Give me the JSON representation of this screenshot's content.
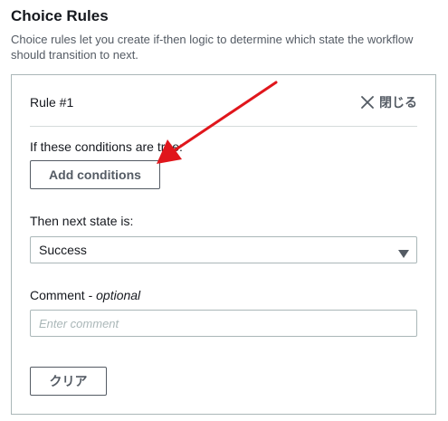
{
  "section": {
    "title": "Choice Rules",
    "description": "Choice rules let you create if-then logic to determine which state the workflow should transition to next."
  },
  "rule": {
    "header": "Rule #1",
    "close_label": "閉じる",
    "conditions_label": "If these conditions are true:",
    "add_conditions_label": "Add conditions",
    "next_state_label": "Then next state is:",
    "next_state_value": "Success",
    "comment_label": "Comment - ",
    "comment_optional": "optional",
    "comment_placeholder": "Enter comment",
    "clear_label": "クリア"
  },
  "colors": {
    "annotation_arrow": "#e0161c",
    "border": "#aab7b8",
    "text": "#16191f",
    "secondary_text": "#545b64"
  },
  "icons": {
    "close": "close-icon",
    "dropdown": "caret-down-icon",
    "annotation": "red-arrow-annotation"
  }
}
